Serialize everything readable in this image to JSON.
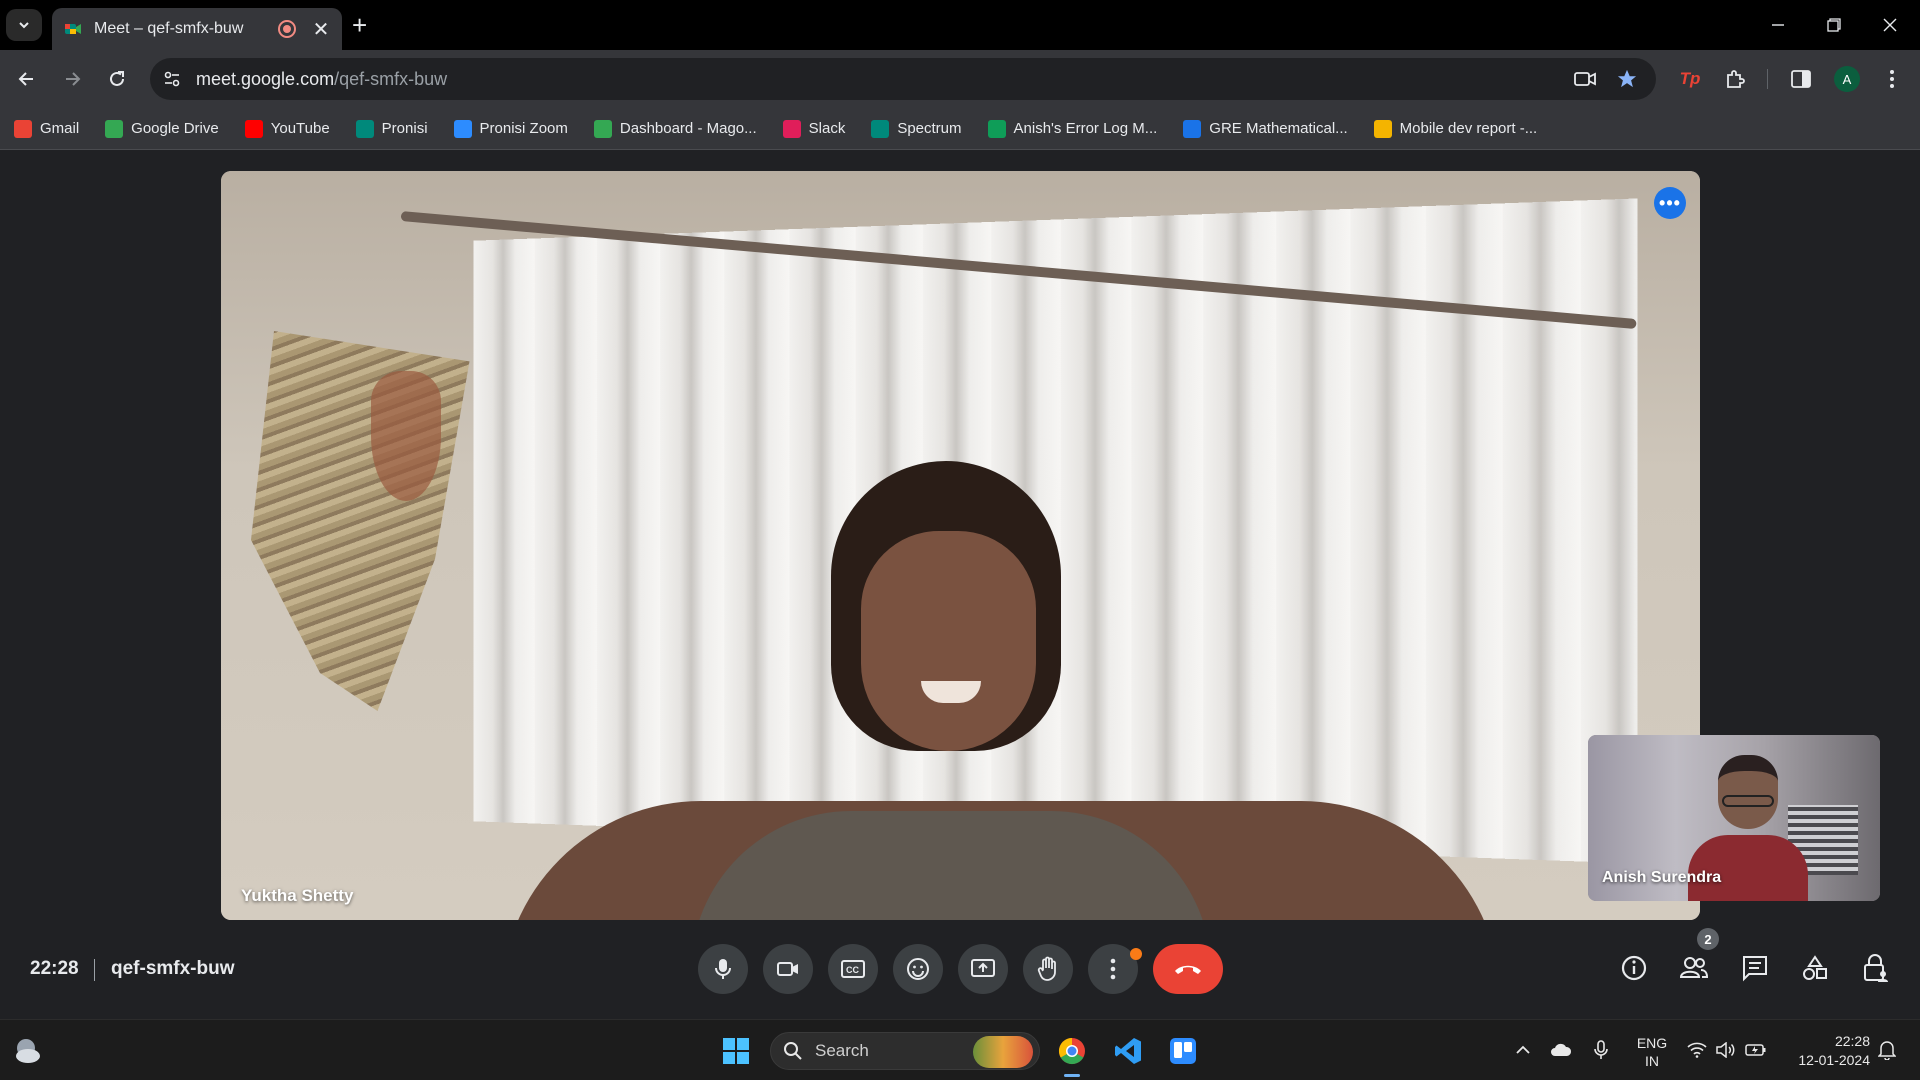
{
  "browser": {
    "tab": {
      "title": "Meet – qef-smfx-buw"
    },
    "url": {
      "host": "meet.google.com",
      "path": "/qef-smfx-buw"
    },
    "profile_initial": "A"
  },
  "bookmarks": [
    {
      "label": "Gmail",
      "icon": "gmail-icon",
      "color": "#ea4335"
    },
    {
      "label": "Google Drive",
      "icon": "google-drive-icon",
      "color": "#34a853"
    },
    {
      "label": "YouTube",
      "icon": "youtube-icon",
      "color": "#ff0000"
    },
    {
      "label": "Pronisi",
      "icon": "google-meet-icon",
      "color": "#00897b"
    },
    {
      "label": "Pronisi Zoom",
      "icon": "zoom-icon",
      "color": "#2d8cff"
    },
    {
      "label": "Dashboard - Mago...",
      "icon": "dashboard-icon",
      "color": "#34a853"
    },
    {
      "label": "Slack",
      "icon": "slack-icon",
      "color": "#e01e5a"
    },
    {
      "label": "Spectrum",
      "icon": "google-meet-icon",
      "color": "#00897b"
    },
    {
      "label": "Anish's Error Log M...",
      "icon": "google-sheets-icon",
      "color": "#0f9d58"
    },
    {
      "label": "GRE Mathematical...",
      "icon": "loading-icon",
      "color": "#1a73e8"
    },
    {
      "label": "Mobile dev report -...",
      "icon": "google-slides-icon",
      "color": "#f4b400"
    }
  ],
  "meet": {
    "main_participant": "Yuktha Shetty",
    "self_participant": "Anish Surendra",
    "time": "22:28",
    "meeting_code": "qef-smfx-buw",
    "people_count": "2",
    "end_call_color": "#ea4335",
    "accent_color": "#1a73e8"
  },
  "taskbar": {
    "search_label": "Search",
    "language": {
      "line1": "ENG",
      "line2": "IN"
    },
    "clock": {
      "time": "22:28",
      "date": "12-01-2024"
    }
  }
}
